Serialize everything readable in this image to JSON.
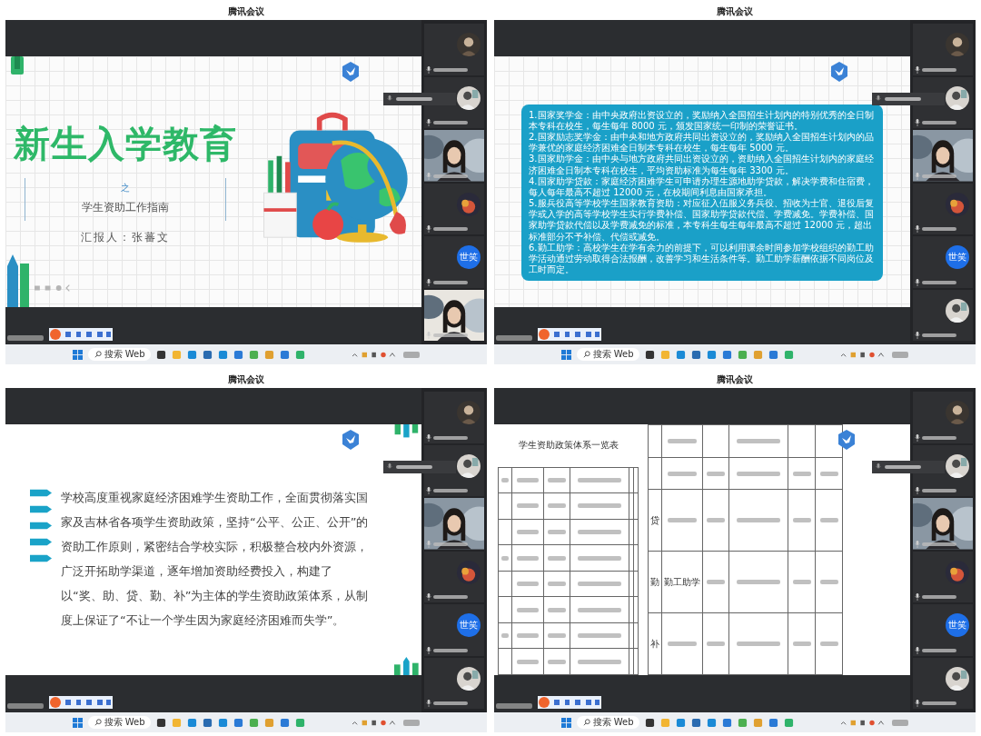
{
  "panels": [
    {
      "window_title": "腾讯会议",
      "slide": {
        "kind": "cover",
        "title": "新生入学教育",
        "connector": "之",
        "subtitle": "学生资助工作指南",
        "presenter": "汇报人：张蕃文"
      },
      "speaker_tooltip": true,
      "tiles": [
        {
          "kind": "avatar"
        },
        {
          "kind": "avatar"
        },
        {
          "kind": "video"
        },
        {
          "kind": "avatar"
        },
        {
          "kind": "badge",
          "label": "世笑"
        },
        {
          "kind": "video"
        }
      ],
      "taskbar": {
        "search": "搜索 Web"
      }
    },
    {
      "window_title": "腾讯会议",
      "slide": {
        "kind": "text_box",
        "paragraphs": [
          "1.国家奖学金：由中央政府出资设立的，奖励纳入全国招生计划内的特别优秀的全日制本专科在校生，每生每年 8000 元，颁发国家统一印制的荣誉证书。",
          "2.国家励志奖学金：由中央和地方政府共同出资设立的，奖励纳入全国招生计划内的品学兼优的家庭经济困难全日制本专科在校生，每生每年 5000 元。",
          "3.国家助学金：由中央与地方政府共同出资设立的，资助纳入全国招生计划内的家庭经济困难全日制本专科在校生，平均资助标准为每生每年 3300 元。",
          "4.国家助学贷款：家庭经济困难学生可申请办理生源地助学贷款，解决学费和住宿费，每人每年最高不超过 12000 元，在校期间利息由国家承担。",
          "5.服兵役高等学校学生国家教育资助：对应征入伍服义务兵役、招收为士官、退役后复学或入学的高等学校学生实行学费补偿、国家助学贷款代偿、学费减免。学费补偿、国家助学贷款代偿以及学费减免的标准，本专科生每生每年最高不超过 12000 元，超出标准部分不予补偿、代偿或减免。",
          "6.勤工助学：高校学生在学有余力的前提下，可以利用课余时间参加学校组织的勤工助学活动通过劳动取得合法报酬，改善学习和生活条件等。勤工助学薪酬依据不同岗位及工时而定。"
        ]
      },
      "speaker_tooltip": true,
      "tiles": [
        {
          "kind": "avatar"
        },
        {
          "kind": "avatar"
        },
        {
          "kind": "video"
        },
        {
          "kind": "avatar"
        },
        {
          "kind": "badge",
          "label": "世笑"
        },
        {
          "kind": "avatar"
        }
      ],
      "taskbar": {
        "search": "搜索 Web"
      }
    },
    {
      "window_title": "腾讯会议",
      "slide": {
        "kind": "bullet_text",
        "text": "学校高度重视家庭经济困难学生资助工作，全面贯彻落实国家及吉林省各项学生资助政策，坚持“公平、公正、公开”的资助工作原则，紧密结合学校实际，积极整合校内外资源，广泛开拓助学渠道，逐年增加资助经费投入，构建了以“奖、助、贷、勤、补”为主体的学生资助政策体系，从制度上保证了“不让一个学生因为家庭经济困难而失学”。"
      },
      "speaker_tooltip": true,
      "tiles": [
        {
          "kind": "avatar"
        },
        {
          "kind": "avatar"
        },
        {
          "kind": "video"
        },
        {
          "kind": "avatar"
        },
        {
          "kind": "badge",
          "label": "世笑"
        },
        {
          "kind": "avatar"
        }
      ],
      "taskbar": {
        "search": "搜索 Web"
      }
    },
    {
      "window_title": "腾讯会议",
      "slide": {
        "kind": "tables",
        "title": "学生资助政策体系一览表",
        "left_rows": [
          [
            {
              "kind": "illegible"
            },
            {
              "kind": "illegible"
            },
            {
              "kind": "illegible"
            },
            {
              "kind": "illegible"
            },
            {
              "kind": "illegible"
            },
            {
              "kind": "illegible"
            }
          ],
          [
            {
              "kind": "empty"
            },
            {
              "kind": "illegible"
            },
            {
              "kind": "illegible"
            },
            {
              "kind": "illegible"
            },
            {
              "kind": "illegible"
            },
            {
              "kind": "illegible"
            }
          ],
          [
            {
              "kind": "empty"
            },
            {
              "kind": "illegible"
            },
            {
              "kind": "illegible"
            },
            {
              "kind": "illegible"
            },
            {
              "kind": "illegible"
            },
            {
              "kind": "illegible"
            }
          ],
          [
            {
              "kind": "illegible"
            },
            {
              "kind": "illegible"
            },
            {
              "kind": "illegible"
            },
            {
              "kind": "illegible"
            },
            {
              "kind": "illegible"
            },
            {
              "kind": "illegible"
            }
          ],
          [
            {
              "kind": "empty"
            },
            {
              "kind": "illegible"
            },
            {
              "kind": "illegible"
            },
            {
              "kind": "illegible"
            },
            {
              "kind": "illegible"
            },
            {
              "kind": "illegible"
            }
          ],
          [
            {
              "kind": "empty"
            },
            {
              "kind": "illegible"
            },
            {
              "kind": "illegible"
            },
            {
              "kind": "illegible"
            },
            {
              "kind": "illegible"
            },
            {
              "kind": "illegible"
            }
          ],
          [
            {
              "kind": "illegible"
            },
            {
              "kind": "illegible"
            },
            {
              "kind": "illegible"
            },
            {
              "kind": "illegible"
            },
            {
              "kind": "illegible"
            },
            {
              "kind": "illegible"
            }
          ],
          [
            {
              "kind": "empty"
            },
            {
              "kind": "illegible"
            },
            {
              "kind": "illegible"
            },
            {
              "kind": "illegible"
            },
            {
              "kind": "illegible"
            },
            {
              "kind": "illegible"
            }
          ]
        ],
        "right_rows": [
          [
            {
              "kind": "empty"
            },
            {
              "kind": "illegible"
            },
            {
              "kind": "empty"
            },
            {
              "kind": "illegible"
            },
            {
              "kind": "empty"
            },
            {
              "kind": "empty"
            }
          ],
          [
            {
              "kind": "empty"
            },
            {
              "kind": "illegible"
            },
            {
              "kind": "illegible"
            },
            {
              "kind": "illegible"
            },
            {
              "kind": "illegible"
            },
            {
              "kind": "illegible"
            }
          ],
          [
            {
              "kind": "text",
              "text": "贷"
            },
            {
              "kind": "illegible"
            },
            {
              "kind": "illegible"
            },
            {
              "kind": "illegible"
            },
            {
              "kind": "illegible"
            },
            {
              "kind": "illegible"
            }
          ],
          [
            {
              "kind": "text",
              "text": "勤"
            },
            {
              "kind": "text",
              "text": "勤工助学"
            },
            {
              "kind": "illegible"
            },
            {
              "kind": "illegible"
            },
            {
              "kind": "illegible"
            },
            {
              "kind": "illegible"
            }
          ],
          [
            {
              "kind": "text",
              "text": "补"
            },
            {
              "kind": "illegible"
            },
            {
              "kind": "illegible"
            },
            {
              "kind": "illegible"
            },
            {
              "kind": "illegible"
            },
            {
              "kind": "illegible"
            }
          ]
        ]
      },
      "speaker_tooltip": true,
      "tiles": [
        {
          "kind": "avatar"
        },
        {
          "kind": "avatar"
        },
        {
          "kind": "video"
        },
        {
          "kind": "avatar"
        },
        {
          "kind": "badge",
          "label": "世笑"
        },
        {
          "kind": "avatar"
        }
      ],
      "taskbar": {
        "search": "搜索 Web"
      }
    }
  ]
}
